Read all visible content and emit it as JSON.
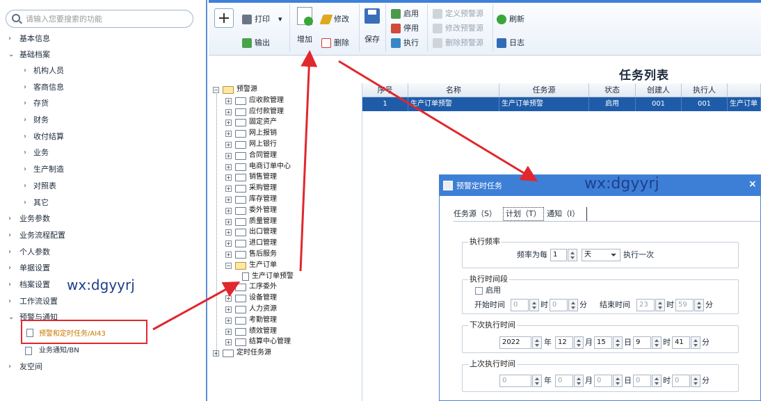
{
  "search": {
    "placeholder": "请输入您要搜索的功能"
  },
  "sidebar": {
    "items": [
      {
        "label": "基本信息",
        "caret": "›",
        "level": 1
      },
      {
        "label": "基础档案",
        "caret": "⌄",
        "level": 1
      },
      {
        "label": "机构人员",
        "caret": "›",
        "level": 2
      },
      {
        "label": "客商信息",
        "caret": "›",
        "level": 2
      },
      {
        "label": "存货",
        "caret": "›",
        "level": 2
      },
      {
        "label": "财务",
        "caret": "›",
        "level": 2
      },
      {
        "label": "收付结算",
        "caret": "›",
        "level": 2
      },
      {
        "label": "业务",
        "caret": "›",
        "level": 2
      },
      {
        "label": "生产制造",
        "caret": "›",
        "level": 2
      },
      {
        "label": "对照表",
        "caret": "›",
        "level": 2
      },
      {
        "label": "其它",
        "caret": "›",
        "level": 2
      },
      {
        "label": "业务参数",
        "caret": "›",
        "level": 1
      },
      {
        "label": "业务流程配置",
        "caret": "›",
        "level": 1
      },
      {
        "label": "个人参数",
        "caret": "›",
        "level": 1
      },
      {
        "label": "单据设置",
        "caret": "›",
        "level": 1
      },
      {
        "label": "档案设置",
        "caret": "›",
        "level": 1
      },
      {
        "label": "工作流设置",
        "caret": "›",
        "level": 1
      },
      {
        "label": "预警与通知",
        "caret": "⌄",
        "level": 1
      }
    ],
    "selected": "预警和定时任务/AI43",
    "leaf_business_notice": "业务通知/BN",
    "last_item": {
      "label": "友空间",
      "caret": "›"
    }
  },
  "watermarks": {
    "left": "wx:dgyyrj",
    "dialog": "wx:dgyyrj"
  },
  "toolbar": {
    "print": "打印",
    "export": "输出",
    "add": "增加",
    "edit": "修改",
    "delete": "删除",
    "save": "保存",
    "enable": "启用",
    "disable": "停用",
    "execute": "执行",
    "define_alert": "定义预警源",
    "modify_alert": "修改预警源",
    "delete_alert": "删除预警源",
    "refresh": "刷新",
    "log": "日志",
    "dropdown_caret": "▾"
  },
  "tree": {
    "root": "预警源",
    "children": [
      "应收款管理",
      "应付款管理",
      "固定资产",
      "网上报销",
      "网上银行",
      "合同管理",
      "电商订单中心",
      "销售管理",
      "采购管理",
      "库存管理",
      "委外管理",
      "质量管理",
      "出口管理",
      "进口管理",
      "售后服务",
      "生产订单",
      "工序委外",
      "设备管理",
      "人力资源",
      "考勤管理",
      "绩效管理",
      "结算中心管理"
    ],
    "leaf": "生产订单预警",
    "timer_root": "定时任务源",
    "plus": "+",
    "minus": "−"
  },
  "grid": {
    "title": "任务列表",
    "columns": [
      "序号",
      "名称",
      "任务源",
      "状态",
      "创建人",
      "执行人",
      ""
    ],
    "rows": [
      {
        "no": "1",
        "name": "生产订单预警",
        "source": "生产订单预警",
        "status": "启用",
        "creator": "001",
        "executor": "001",
        "extra": "生产订单"
      }
    ]
  },
  "dialog": {
    "title": "预警定时任务",
    "close": "×",
    "tabs": [
      "任务源（S）",
      "计划（T）",
      "通知（I）"
    ],
    "freq": {
      "title": "执行频率",
      "prefix": "频率为每",
      "value": "1",
      "unit": "天",
      "suffix": "执行一次"
    },
    "period": {
      "title": "执行时间段",
      "enable": "启用",
      "start_label": "开始时间",
      "start_h": "0",
      "start_m": "0",
      "end_label": "结束时间",
      "end_h": "23",
      "end_m": "59",
      "hour": "时",
      "minute": "分"
    },
    "next": {
      "title": "下次执行时间",
      "year": "2022",
      "month": "12",
      "day": "15",
      "hour": "9",
      "minute": "41"
    },
    "last": {
      "title": "上次执行时间",
      "year": "0",
      "month": "0",
      "day": "0",
      "hour": "0",
      "minute": "0"
    },
    "units": {
      "year": "年",
      "month": "月",
      "day": "日",
      "hour": "时",
      "minute": "分"
    }
  },
  "colors": {
    "accent": "#3d7fd6",
    "row_selected": "#1e5ca9",
    "highlight_border": "#e0282d",
    "arrow": "#e0282d",
    "selected_text": "#c77700"
  }
}
